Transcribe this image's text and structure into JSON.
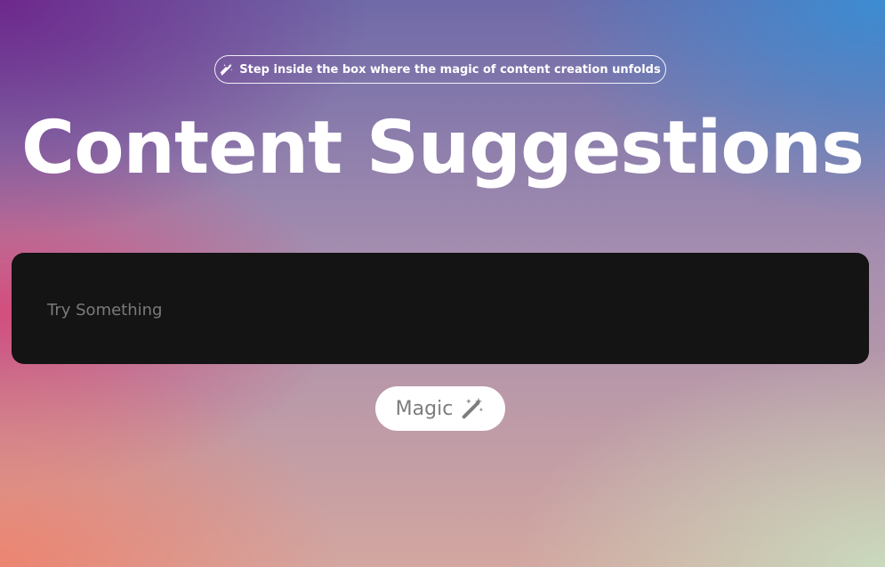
{
  "badge": {
    "icon": "magic-wand-icon",
    "text": "Step inside the box where the magic of content creation unfolds"
  },
  "page": {
    "title": "Content Suggestions"
  },
  "prompt_input": {
    "value": "",
    "placeholder": "Try Something"
  },
  "magic_button": {
    "label": "Magic",
    "icon": "magic-wand-icon"
  },
  "colors": {
    "input_background": "#141414",
    "button_background": "#ffffff",
    "button_text": "#7d7d7d",
    "title_text": "#ffffff"
  }
}
